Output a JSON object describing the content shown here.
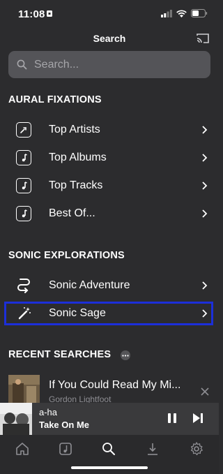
{
  "status": {
    "time": "11:08"
  },
  "header": {
    "title": "Search"
  },
  "search": {
    "placeholder": "Search..."
  },
  "section_aural": {
    "title": "AURAL FIXATIONS",
    "items": [
      {
        "label": "Top Artists",
        "icon": "microphone-icon"
      },
      {
        "label": "Top Albums",
        "icon": "music-note-icon"
      },
      {
        "label": "Top Tracks",
        "icon": "music-note-icon"
      },
      {
        "label": "Best Of...",
        "icon": "music-note-icon"
      }
    ]
  },
  "section_sonic": {
    "title": "SONIC EXPLORATIONS",
    "items": [
      {
        "label": "Sonic Adventure",
        "icon": "path-icon"
      },
      {
        "label": "Sonic Sage",
        "icon": "magic-wand-icon"
      }
    ]
  },
  "recent": {
    "title": "RECENT SEARCHES",
    "items": [
      {
        "title": "If You Could Read My Mi...",
        "subtitle": "Gordon Lightfoot"
      }
    ]
  },
  "now_playing": {
    "artist": "a-ha",
    "title": "Take On Me"
  },
  "colors": {
    "background": "#2c2c2e",
    "highlight": "#1c2fd9",
    "search_bg": "#545458"
  }
}
